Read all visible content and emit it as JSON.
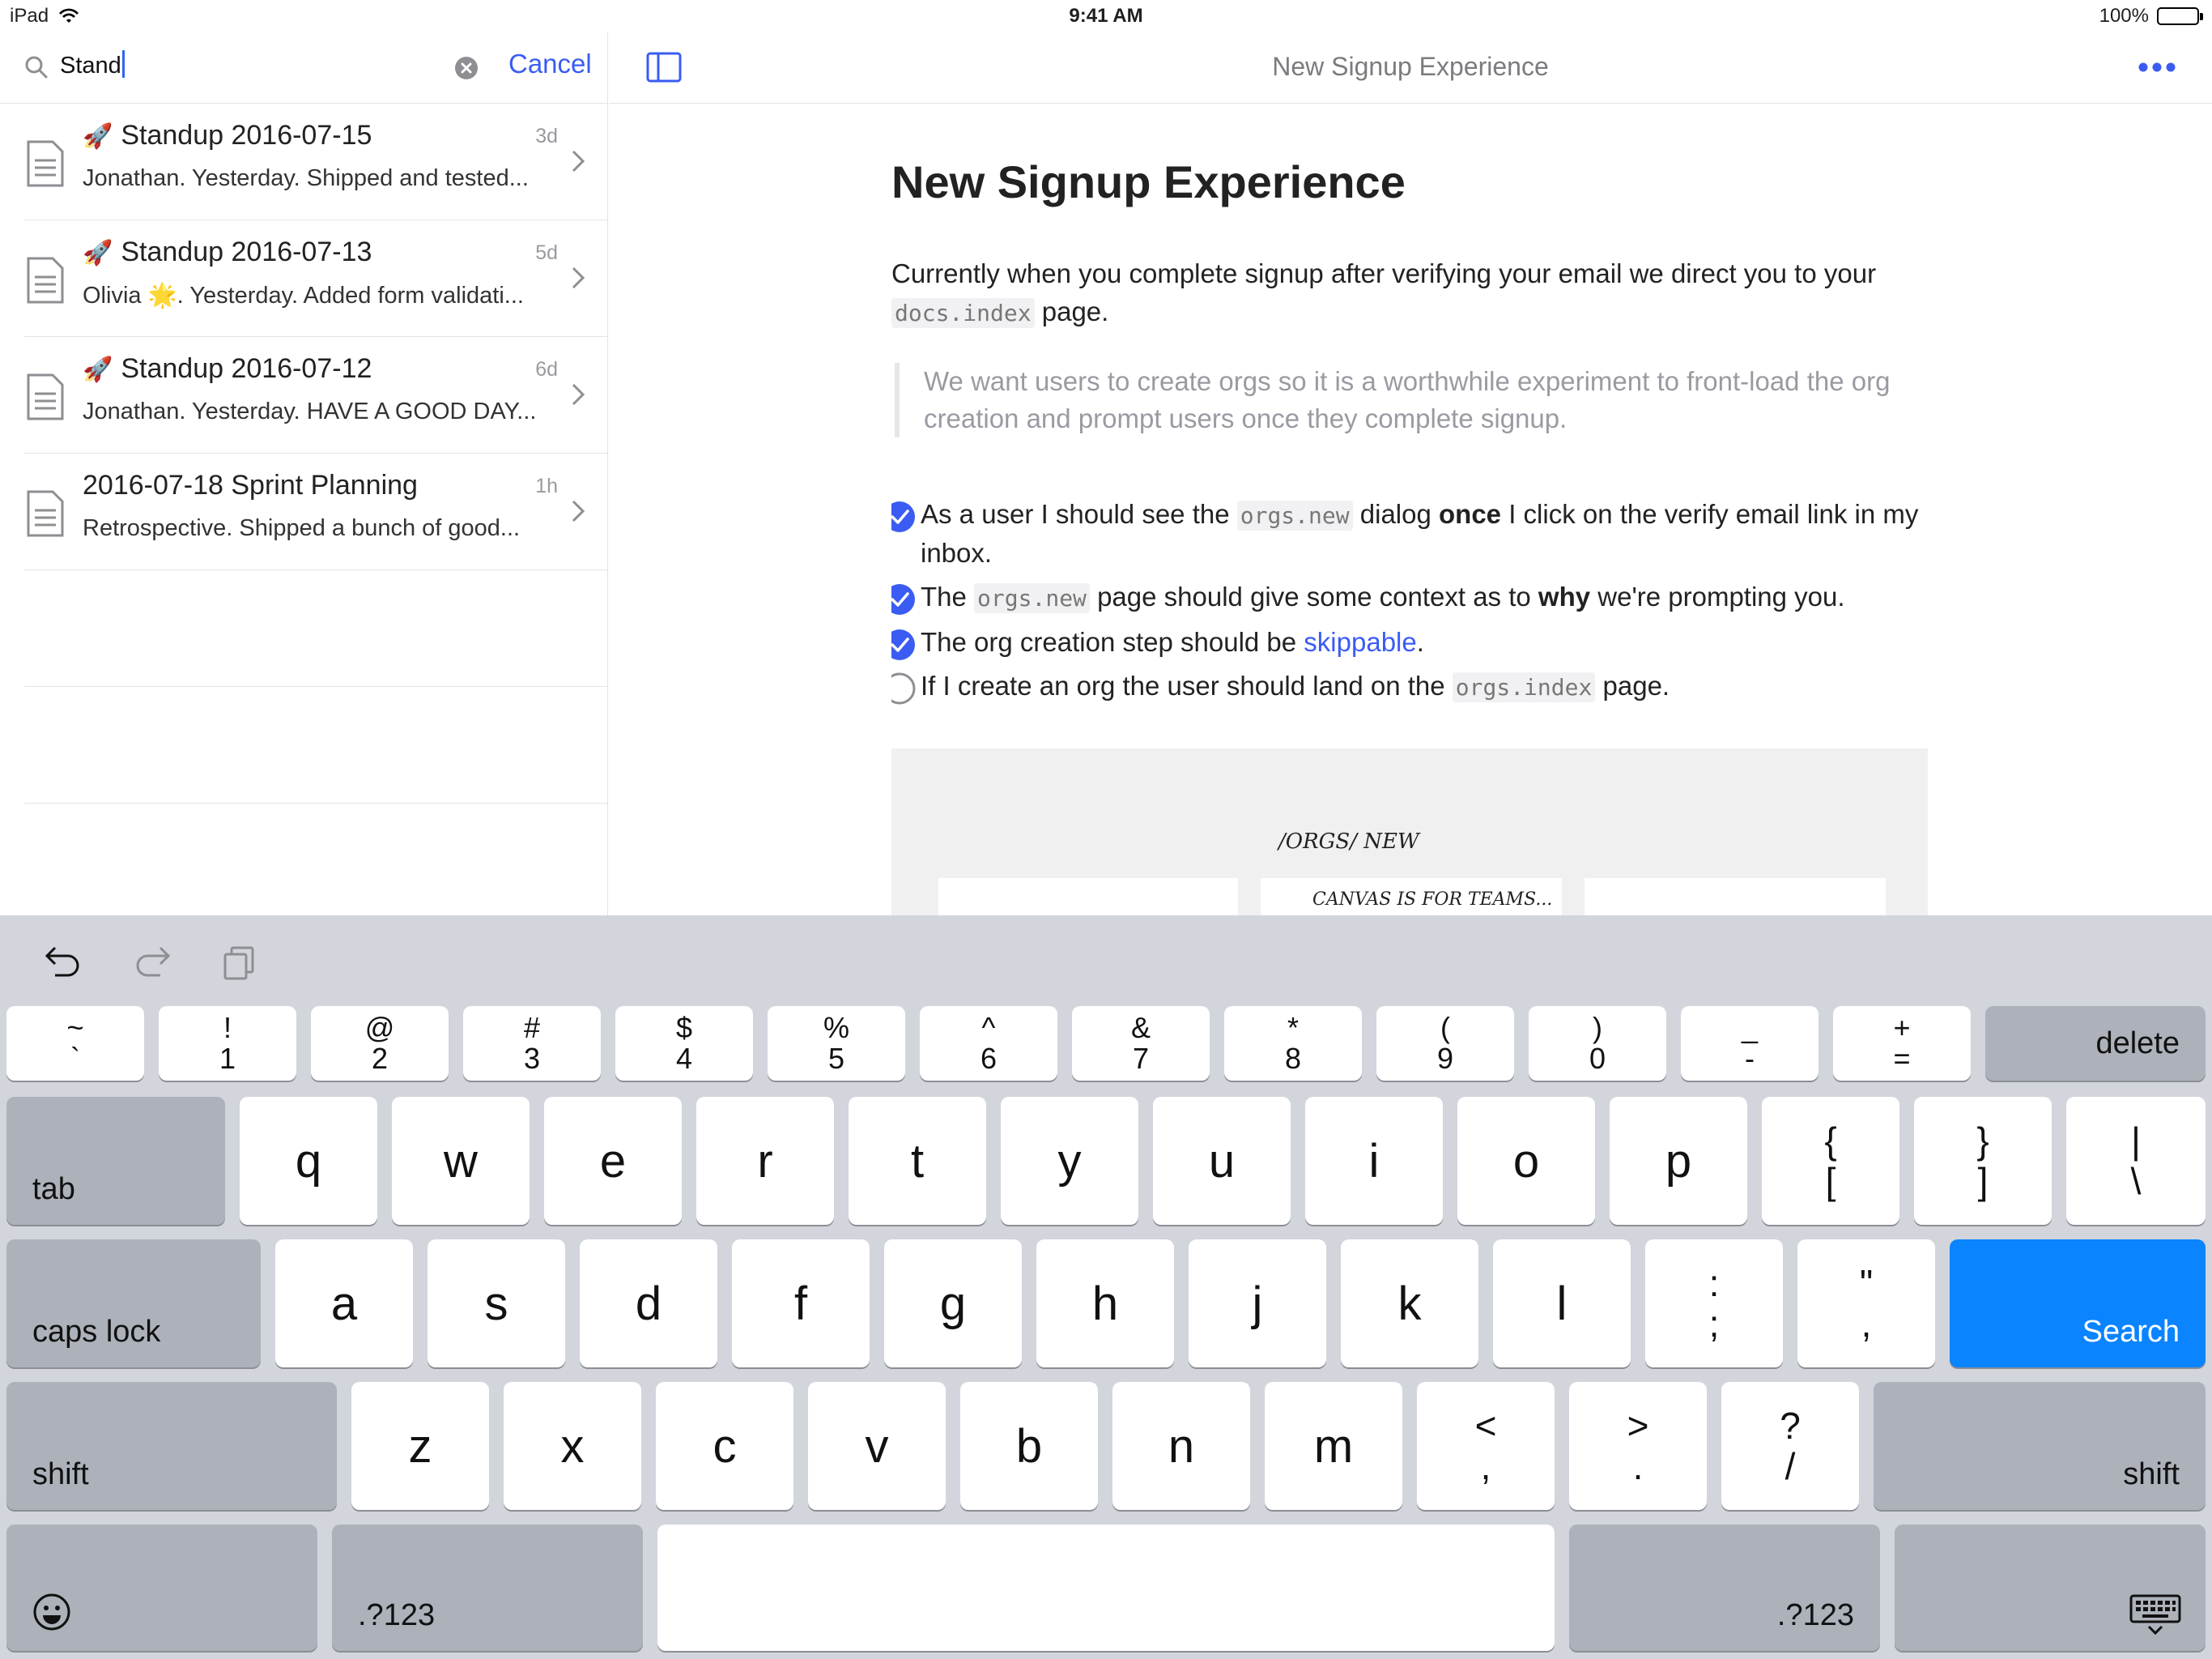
{
  "status": {
    "device": "iPad",
    "time": "9:41 AM",
    "battery": "100%"
  },
  "search": {
    "value": "Stand",
    "cancel": "Cancel"
  },
  "results": [
    {
      "emoji": "🚀",
      "title": "Standup 2016-07-15",
      "age": "3d",
      "subtitle": "Jonathan. Yesterday. Shipped and tested..."
    },
    {
      "emoji": "🚀",
      "title": "Standup 2016-07-13",
      "age": "5d",
      "subtitle": "Olivia 🌟. Yesterday. Added form validati..."
    },
    {
      "emoji": "🚀",
      "title": "Standup 2016-07-12",
      "age": "6d",
      "subtitle": "Jonathan. Yesterday. HAVE A GOOD DAY..."
    },
    {
      "emoji": "",
      "title": "2016-07-18 Sprint Planning",
      "age": "1h",
      "subtitle": "Retrospective. Shipped a bunch of good..."
    }
  ],
  "topbar": {
    "title": "New Signup Experience"
  },
  "doc": {
    "title": "New Signup Experience",
    "para": {
      "before": "Currently when you complete signup after verifying your email we direct you to your ",
      "code": "docs.index",
      "after": " page."
    },
    "quote": "We want users to create orgs so it is a worthwhile experiment to front-load the org creation and prompt users once they complete signup.",
    "tasks": [
      {
        "checked": true,
        "t1": "As a user I should see the ",
        "code": "orgs.new",
        "t2": " dialog ",
        "bold": "once",
        "t3": " I click on the verify email link in my inbox."
      },
      {
        "checked": true,
        "t1": "The ",
        "code": "orgs.new",
        "t2": " page should give some context as to ",
        "bold": "why",
        "t3": " we're prompting you."
      },
      {
        "checked": true,
        "t1": "The org creation step should be ",
        "link": "skippable",
        "t3": "."
      },
      {
        "checked": false,
        "t1": "If I create an org the user should land on the ",
        "code": "orgs.index",
        "t3": " page."
      }
    ],
    "sketch": {
      "path": "/ORGS/ NEW",
      "caption": "CANVAS IS FOR TEAMS..."
    }
  },
  "keyboard": {
    "row0": [
      [
        "~",
        "`"
      ],
      [
        "!",
        "1"
      ],
      [
        "@",
        "2"
      ],
      [
        "#",
        "3"
      ],
      [
        "$",
        "4"
      ],
      [
        "%",
        "5"
      ],
      [
        "^",
        "6"
      ],
      [
        "&",
        "7"
      ],
      [
        "*",
        "8"
      ],
      [
        "(",
        "9"
      ],
      [
        ")",
        "0"
      ],
      [
        "_",
        "-"
      ],
      [
        "+",
        "="
      ]
    ],
    "delete": "delete",
    "tab": "tab",
    "row1": [
      "q",
      "w",
      "e",
      "r",
      "t",
      "y",
      "u",
      "i",
      "o",
      "p"
    ],
    "row1b": [
      [
        "{",
        "["
      ],
      [
        "}",
        "]"
      ],
      [
        "|",
        "\\"
      ]
    ],
    "caps": "caps lock",
    "row2": [
      "a",
      "s",
      "d",
      "f",
      "g",
      "h",
      "j",
      "k",
      "l"
    ],
    "row2b": [
      [
        ":",
        ";"
      ],
      [
        "\"",
        ","
      ]
    ],
    "search": "Search",
    "shift": "shift",
    "row3": [
      "z",
      "x",
      "c",
      "v",
      "b",
      "n",
      "m"
    ],
    "row3b": [
      [
        "<",
        ","
      ],
      [
        ">",
        "."
      ],
      [
        "?",
        "/"
      ]
    ],
    "numkey": ".?123"
  },
  "colors": {
    "accent": "#3a5cf3",
    "search_key": "#0a84ff",
    "keyboard_bg": "#d2d5db"
  }
}
